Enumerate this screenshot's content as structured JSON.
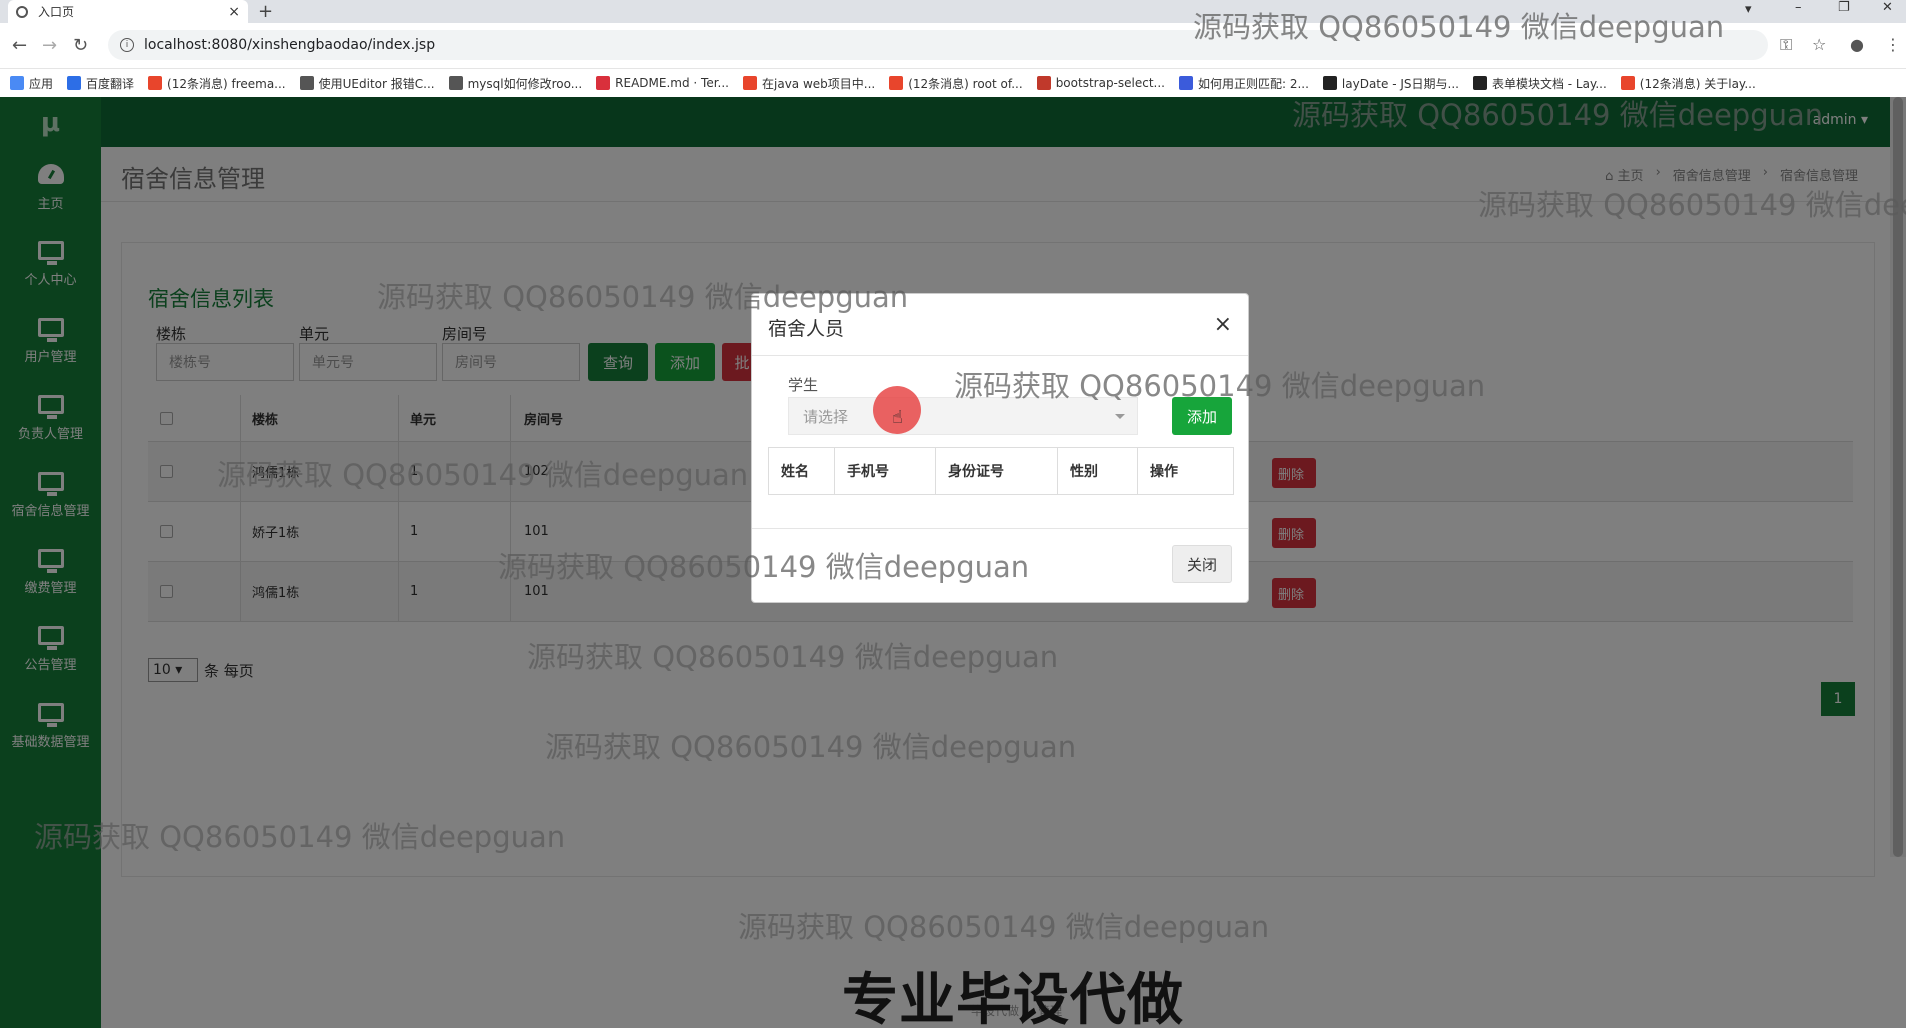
{
  "browser": {
    "tab_title": "入口页",
    "url": "localhost:8080/xinshengbaodao/index.jsp",
    "bookmarks": [
      {
        "label": "应用",
        "color": "#4a8af4"
      },
      {
        "label": "百度翻译",
        "color": "#2d6ee6"
      },
      {
        "label": "(12条消息) freema...",
        "color": "#e8452c"
      },
      {
        "label": "使用UEditor 报错C...",
        "color": "#555555"
      },
      {
        "label": "mysql如何修改roo...",
        "color": "#555555"
      },
      {
        "label": "README.md · Ter...",
        "color": "#d9303c"
      },
      {
        "label": "在java web项目中...",
        "color": "#e8452c"
      },
      {
        "label": "(12条消息) root of...",
        "color": "#e8452c"
      },
      {
        "label": "bootstrap-select...",
        "color": "#c0392b"
      },
      {
        "label": "如何用正则匹配: 2...",
        "color": "#3b5bdb"
      },
      {
        "label": "layDate - JS日期与...",
        "color": "#222222"
      },
      {
        "label": "表单模块文档 - Lay...",
        "color": "#222222"
      },
      {
        "label": "(12条消息) 关于lay...",
        "color": "#e8452c"
      }
    ]
  },
  "app": {
    "logo": "μ",
    "user": "admin",
    "sidebar": [
      {
        "label": "主页",
        "icon": "dashboard-icon"
      },
      {
        "label": "个人中心",
        "icon": "monitor-icon"
      },
      {
        "label": "用户管理",
        "icon": "monitor-icon"
      },
      {
        "label": "负责人管理",
        "icon": "monitor-icon"
      },
      {
        "label": "宿舍信息管理",
        "icon": "monitor-icon"
      },
      {
        "label": "缴费管理",
        "icon": "monitor-icon"
      },
      {
        "label": "公告管理",
        "icon": "monitor-icon"
      },
      {
        "label": "基础数据管理",
        "icon": "monitor-icon"
      }
    ],
    "page_title": "宿舍信息管理",
    "breadcrumb": [
      "主页",
      "宿舍信息管理",
      "宿舍信息管理"
    ],
    "card_title": "宿舍信息列表",
    "filters": [
      {
        "label": "楼栋",
        "placeholder": "楼栋号"
      },
      {
        "label": "单元",
        "placeholder": "单元号"
      },
      {
        "label": "房间号",
        "placeholder": "房间号"
      }
    ],
    "buttons": {
      "query": "查询",
      "add": "添加",
      "batch": "批"
    },
    "table": {
      "headers": [
        "楼栋",
        "单元",
        "房间号"
      ],
      "rows": [
        {
          "building": "鸿儒1栋",
          "unit": "1",
          "room": "102",
          "delete": "删除"
        },
        {
          "building": "娇子1栋",
          "unit": "1",
          "room": "101",
          "delete": "删除"
        },
        {
          "building": "鸿儒1栋",
          "unit": "1",
          "room": "101",
          "delete": "删除"
        }
      ]
    },
    "page_size": "10",
    "page_size_suffix": "条 每页",
    "current_page": "1",
    "footer": "毕设代做 ... 管理"
  },
  "modal": {
    "title": "宿舍人员",
    "field_label": "学生",
    "select_placeholder": "请选择",
    "add_label": "添加",
    "headers": [
      "姓名",
      "手机号",
      "身份证号",
      "性别",
      "操作"
    ],
    "close_label": "关闭"
  },
  "watermark": "源码获取 QQ86050149 微信deepguan",
  "banner": "专业毕设代做"
}
